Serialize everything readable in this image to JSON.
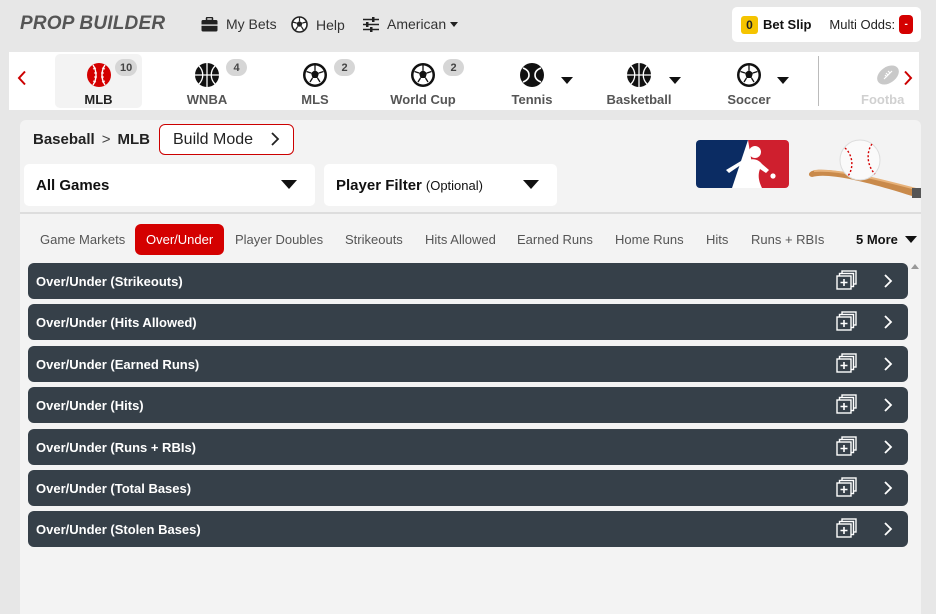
{
  "app": {
    "brand": "PROP BUILDER"
  },
  "topnav": {
    "my_bets": "My Bets",
    "help": "Help",
    "odds_format": "American"
  },
  "betslip": {
    "count": "0",
    "label": "Bet Slip",
    "multi_odds_label": "Multi Odds:",
    "multi_odds_value": "-"
  },
  "sports": [
    {
      "label": "MLB",
      "count": "10",
      "icon": "baseball-icon",
      "active": true
    },
    {
      "label": "WNBA",
      "count": "4",
      "icon": "basketball-icon"
    },
    {
      "label": "MLS",
      "count": "2",
      "icon": "soccer-ball-icon"
    },
    {
      "label": "World Cup",
      "count": "2",
      "icon": "soccer-ball-icon"
    },
    {
      "label": "Tennis",
      "icon": "tennis-ball-icon",
      "dropdown": true
    },
    {
      "label": "Basketball",
      "icon": "basketball-icon",
      "dropdown": true
    },
    {
      "label": "Soccer",
      "icon": "soccer-ball-icon",
      "dropdown": true
    },
    {
      "label": "Footba",
      "icon": "football-icon"
    }
  ],
  "breadcrumb": {
    "sport": "Baseball",
    "separator": ">",
    "league": "MLB"
  },
  "build_mode": {
    "label": "Build Mode"
  },
  "filters": {
    "games": "All Games",
    "player_filter": "Player Filter",
    "player_filter_hint": "(Optional)"
  },
  "tabs": [
    {
      "label": "Game Markets"
    },
    {
      "label": "Over/Under",
      "active": true
    },
    {
      "label": "Player Doubles"
    },
    {
      "label": "Strikeouts"
    },
    {
      "label": "Hits Allowed"
    },
    {
      "label": "Earned Runs"
    },
    {
      "label": "Home Runs"
    },
    {
      "label": "Hits"
    },
    {
      "label": "Runs + RBIs"
    }
  ],
  "more_tabs": "5 More",
  "markets": [
    "Over/Under (Strikeouts)",
    "Over/Under (Hits Allowed)",
    "Over/Under (Earned Runs)",
    "Over/Under (Hits)",
    "Over/Under (Runs + RBIs)",
    "Over/Under (Total Bases)",
    "Over/Under (Stolen Bases)"
  ],
  "colors": {
    "accent": "#d40000",
    "market_bar": "#364049",
    "badge": "#f5c400"
  }
}
